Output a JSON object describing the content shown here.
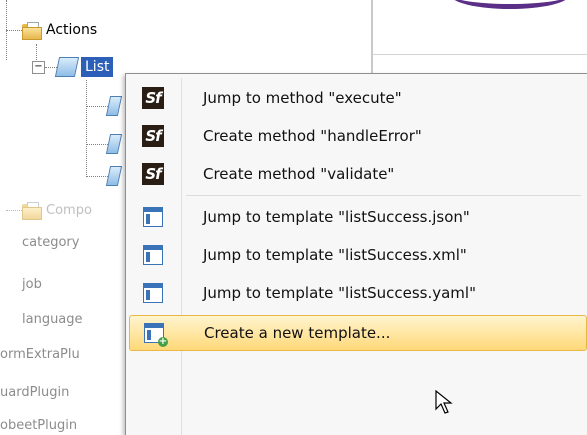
{
  "tree": {
    "actions_label": "Actions",
    "list_label": "List",
    "components_label": "Compo",
    "faded_items": [
      "category",
      "job",
      "language",
      "ormExtraPlu",
      "uardPlugin",
      "obeetPlugin"
    ]
  },
  "context_menu": {
    "items": [
      {
        "icon": "symfony-icon",
        "label": "Jump to method \"execute\""
      },
      {
        "icon": "symfony-icon",
        "label": "Create method \"handleError\""
      },
      {
        "icon": "symfony-icon",
        "label": "Create method \"validate\""
      },
      {
        "icon": "template-icon",
        "label": "Jump to template \"listSuccess.json\""
      },
      {
        "icon": "template-icon",
        "label": "Jump to template \"listSuccess.xml\""
      },
      {
        "icon": "template-icon",
        "label": "Jump to template \"listSuccess.yaml\""
      },
      {
        "icon": "new-template-icon",
        "label": "Create a new template..."
      }
    ],
    "icon_text": "Sf",
    "highlighted_index": 6
  },
  "colors": {
    "selection": "#2b5fb8",
    "highlight": "#ffd978",
    "accent": "#5b2f87"
  }
}
